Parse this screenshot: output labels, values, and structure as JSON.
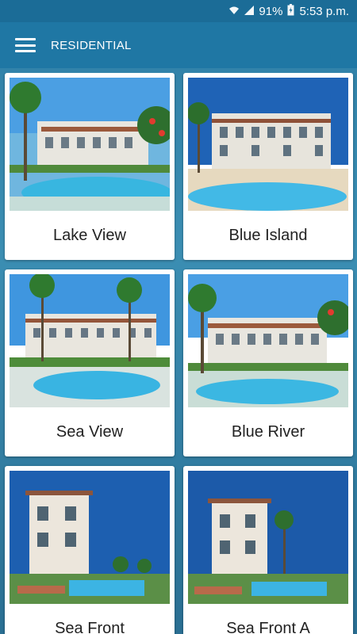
{
  "status": {
    "battery": "91%",
    "time": "5:53 p.m.",
    "wifi_icon": "wifi-icon",
    "signal_icon": "signal-icon",
    "battery_icon": "battery-charging-icon"
  },
  "appbar": {
    "title": "RESIDENTIAL",
    "menu_icon": "hamburger-menu-icon"
  },
  "colors": {
    "appbar": "#1f77a4",
    "statusbar": "#1b6c97",
    "card": "#ffffff"
  },
  "cards": [
    {
      "label": "Lake View",
      "variant": "villa-pool"
    },
    {
      "label": "Blue Island",
      "variant": "villa-pool"
    },
    {
      "label": "Sea View",
      "variant": "resort-pool"
    },
    {
      "label": "Blue River",
      "variant": "villa-pool"
    },
    {
      "label": "Sea Front",
      "variant": "townhouse"
    },
    {
      "label": "Sea Front A",
      "variant": "townhouse"
    }
  ]
}
